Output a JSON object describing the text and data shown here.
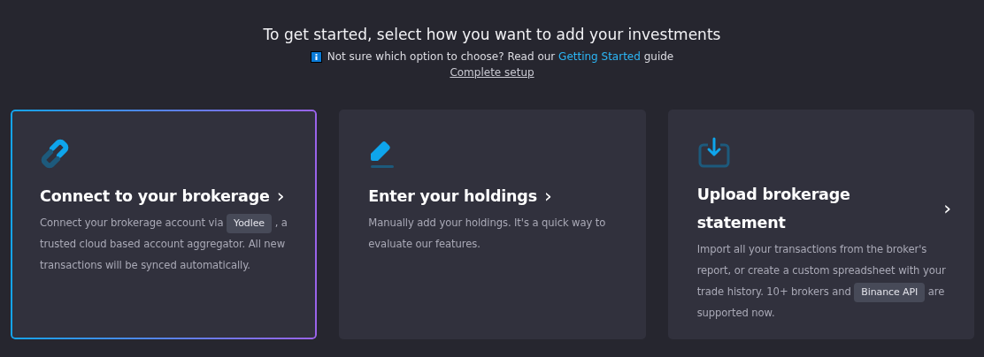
{
  "heading": {
    "title": "To get started, select how you want to add your investments",
    "hint": [
      {
        "kind": "text",
        "text": "Not sure which option to choose? Read our "
      },
      {
        "kind": "link",
        "text": "Getting Started"
      },
      {
        "kind": "text",
        "text": " guide"
      }
    ],
    "setup_link": "Complete setup"
  },
  "options": [
    {
      "kind": "connect",
      "title": "Connect to your brokerage",
      "chevron": "›",
      "selected": true,
      "description": [
        {
          "kind": "text",
          "text": "Connect your brokerage account via "
        },
        {
          "kind": "badge",
          "text": "Yodlee"
        },
        {
          "kind": "text",
          "text": " , a trusted cloud based account aggregator. All new transactions will be synced automatically."
        }
      ]
    },
    {
      "kind": "manual",
      "title": "Enter your holdings",
      "chevron": "›",
      "selected": false,
      "description": [
        {
          "kind": "text",
          "text": "Manually add your holdings. It's a quick way to evaluate our features."
        }
      ]
    },
    {
      "kind": "upload",
      "title": "Upload brokerage statement",
      "chevron": "›",
      "selected": false,
      "description": [
        {
          "kind": "text",
          "text": "Import all your transactions from the broker's report, or create a custom spreadsheet with your trade history. 10+ brokers and "
        },
        {
          "kind": "badge",
          "text": "Binance API"
        },
        {
          "kind": "text",
          "text": " are supported now."
        }
      ]
    }
  ]
}
